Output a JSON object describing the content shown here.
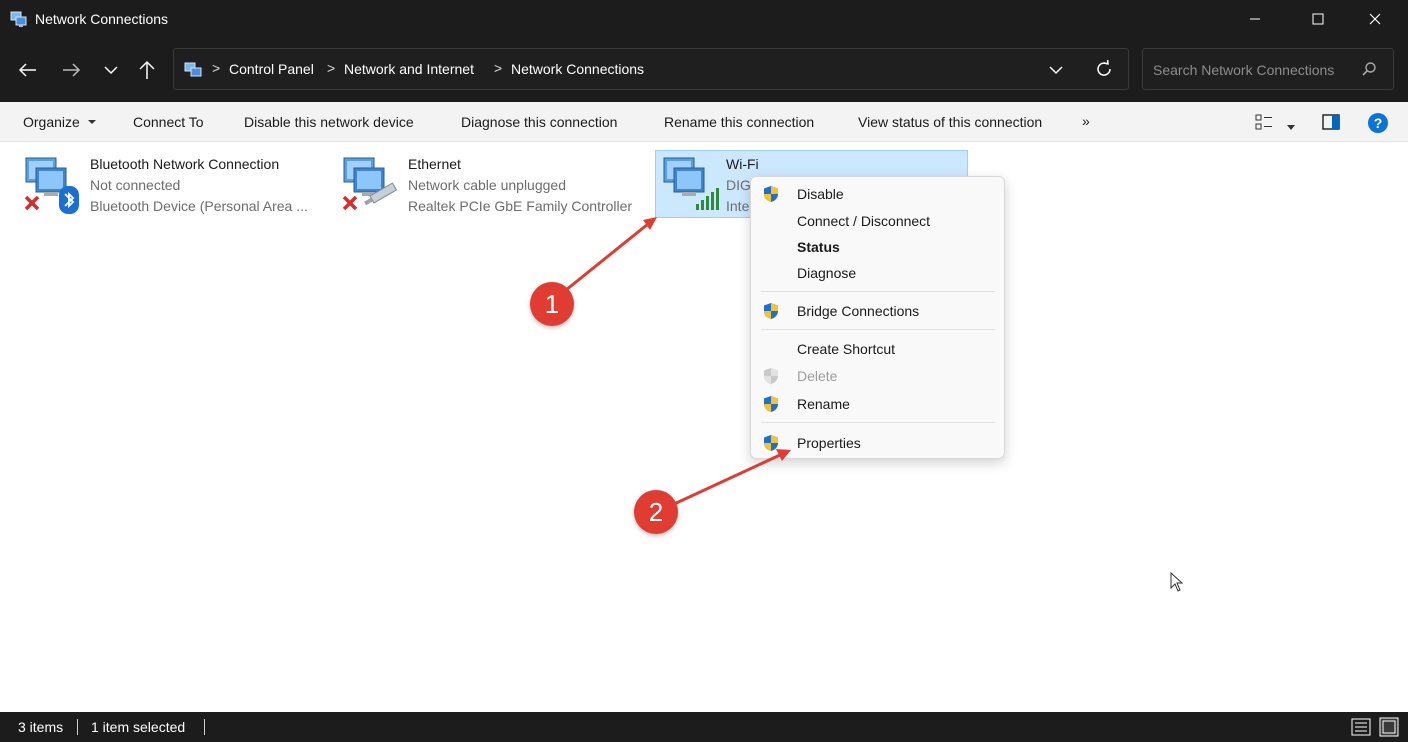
{
  "window": {
    "title": "Network Connections",
    "icons": [
      "network-connections-icon",
      "minimize-icon",
      "maximize-icon",
      "close-icon"
    ]
  },
  "navigation": {
    "icons": [
      "back-arrow-icon",
      "forward-arrow-icon",
      "chevron-down-icon",
      "up-arrow-icon"
    ]
  },
  "address": {
    "separator": ">",
    "breadcrumbs": [
      "Control Panel",
      "Network and Internet",
      "Network Connections"
    ],
    "icons": [
      "control-panel-icon",
      "chevron-down-icon",
      "refresh-icon"
    ]
  },
  "search": {
    "placeholder": "Search Network Connections",
    "icon": "search-icon"
  },
  "toolbar": {
    "organize": "Organize",
    "connect_to": "Connect To",
    "disable_device": "Disable this network device",
    "diagnose": "Diagnose this connection",
    "rename": "Rename this connection",
    "view_status": "View status of this connection",
    "more": "»",
    "icons": [
      "change-view-icon",
      "preview-pane-icon",
      "help-icon"
    ]
  },
  "connections": [
    {
      "name": "Bluetooth Network Connection",
      "status": "Not connected",
      "device": "Bluetooth Device (Personal Area ...",
      "icon": "bluetooth-network-icon",
      "overlay": "disconnected-x-icon"
    },
    {
      "name": "Ethernet",
      "status": "Network cable unplugged",
      "device": "Realtek PCIe GbE Family Controller",
      "icon": "ethernet-network-icon",
      "overlay": "disconnected-x-icon"
    },
    {
      "name": "Wi-Fi",
      "status": "DIG",
      "device": "Inte",
      "icon": "wifi-network-icon",
      "selected": true
    }
  ],
  "context_menu": {
    "items": [
      {
        "label": "Disable",
        "shield": true
      },
      {
        "label": "Connect / Disconnect",
        "shield": false
      },
      {
        "label": "Status",
        "shield": false,
        "bold": true
      },
      {
        "label": "Diagnose",
        "shield": false
      },
      {
        "label": "Bridge Connections",
        "shield": true
      },
      {
        "label": "Create Shortcut",
        "shield": false
      },
      {
        "label": "Delete",
        "shield": true,
        "disabled": true
      },
      {
        "label": "Rename",
        "shield": true
      },
      {
        "label": "Properties",
        "shield": true
      }
    ]
  },
  "annotations": {
    "step1": "1",
    "step2": "2",
    "color": "#e03c31"
  },
  "statusbar": {
    "item_count": "3 items",
    "selection": "1 item selected",
    "icons": [
      "details-view-icon",
      "large-icons-view-icon"
    ]
  },
  "colors": {
    "chrome_dark": "#1c1c1c",
    "selection": "#cce8ff",
    "accent": "#0067c0"
  }
}
